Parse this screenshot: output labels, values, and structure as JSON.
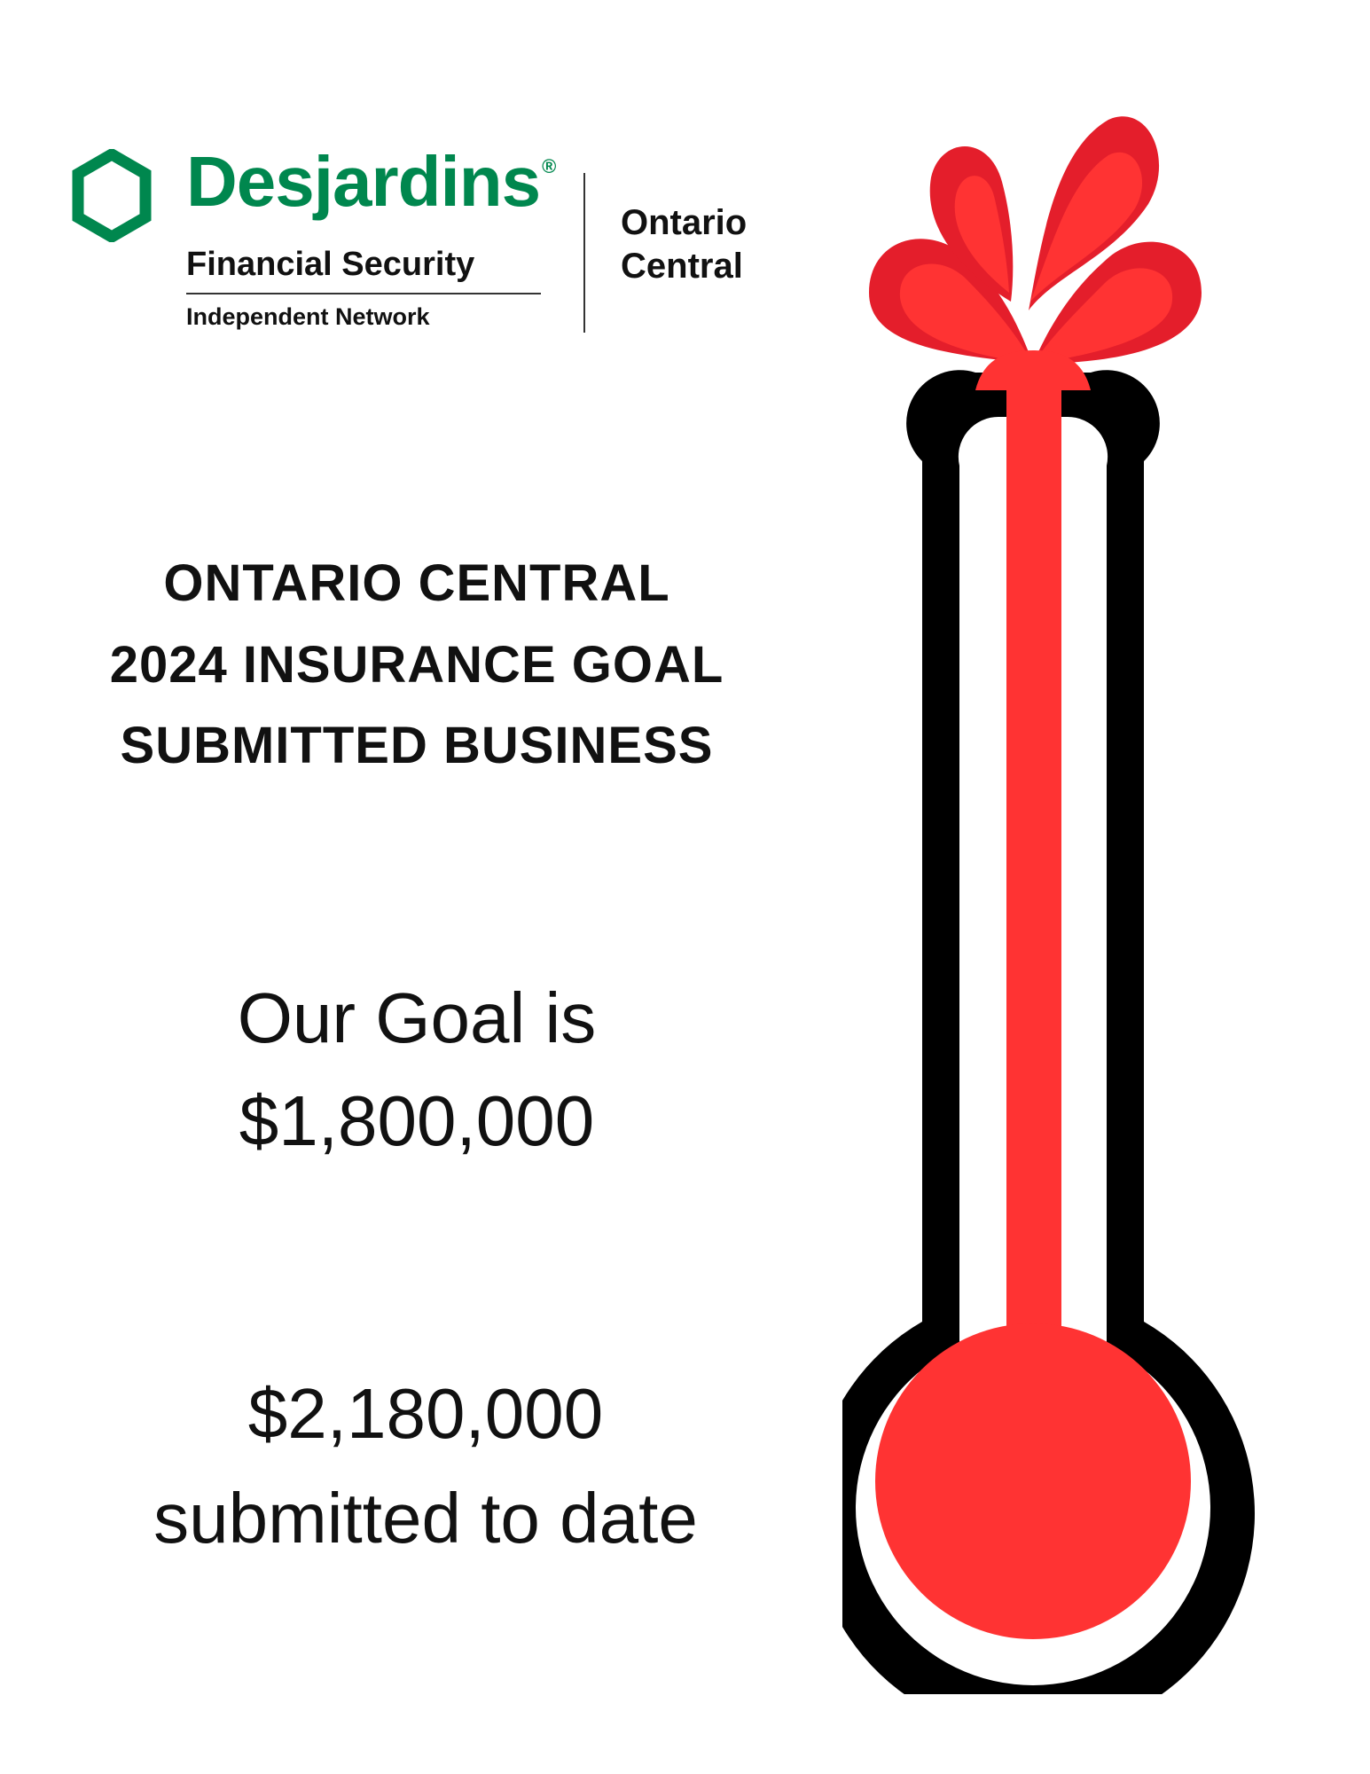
{
  "logo": {
    "brand": "Desjardins",
    "registered_mark": "®",
    "line1": "Financial Security",
    "line2": "Independent Network",
    "region_line1": "Ontario",
    "region_line2": "Central",
    "brand_color": "#00874e"
  },
  "heading": {
    "line1": "ONTARIO CENTRAL",
    "line2": "2024 INSURANCE GOAL",
    "line3": "SUBMITTED BUSINESS"
  },
  "goal": {
    "line1": "Our Goal is",
    "amount": "$1,800,000"
  },
  "progress": {
    "amount": "$2,180,000",
    "caption": "submitted to date"
  },
  "thermometer": {
    "goal_value": 1800000,
    "submitted_value": 2180000,
    "fill_fraction": 1.0,
    "overflowing": true,
    "fill_color": "#ff3333",
    "fill_dark_color": "#e41e2b",
    "outline_color": "#000000"
  }
}
